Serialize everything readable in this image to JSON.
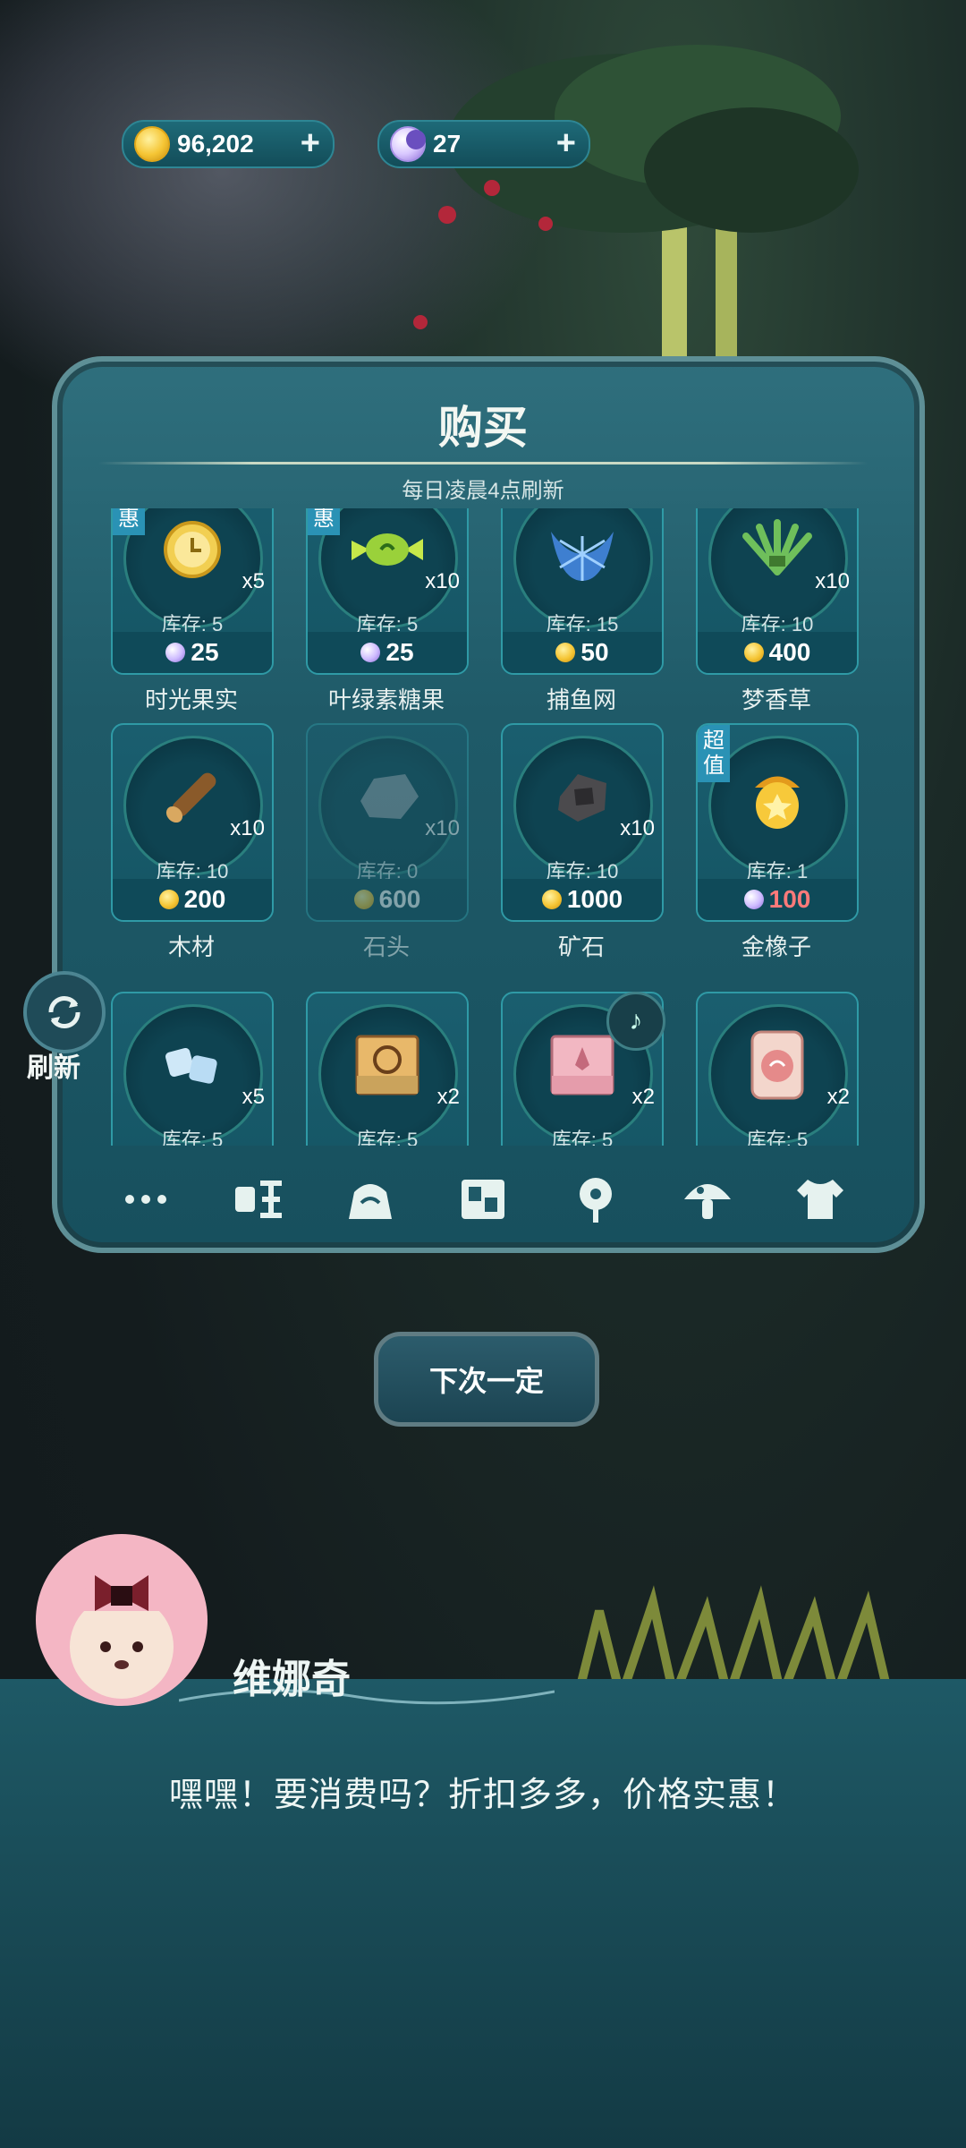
{
  "currencies": [
    {
      "icon": "gold-coin-icon",
      "amount": "96,202"
    },
    {
      "icon": "moon-gem-icon",
      "amount": "27"
    }
  ],
  "shop": {
    "title": "购买",
    "subtitle": "每日凌晨4点刷新",
    "items": [
      {
        "name": "时光果实",
        "qty": "x5",
        "stock": "库存: 5",
        "currency": "moon",
        "price": "25",
        "badge": "特惠"
      },
      {
        "name": "叶绿素糖果",
        "qty": "x10",
        "stock": "库存: 5",
        "currency": "moon",
        "price": "25",
        "badge": "特惠"
      },
      {
        "name": "捕鱼网",
        "qty": "",
        "stock": "库存: 15",
        "currency": "coin",
        "price": "50",
        "badge": ""
      },
      {
        "name": "梦香草",
        "qty": "x10",
        "stock": "库存: 10",
        "currency": "coin",
        "price": "400",
        "badge": ""
      },
      {
        "name": "木材",
        "qty": "x10",
        "stock": "库存: 10",
        "currency": "coin",
        "price": "200",
        "badge": ""
      },
      {
        "name": "石头",
        "qty": "x10",
        "stock": "库存: 0",
        "currency": "coin",
        "price": "600",
        "badge": "",
        "disabled": true
      },
      {
        "name": "矿石",
        "qty": "x10",
        "stock": "库存: 10",
        "currency": "coin",
        "price": "1000",
        "badge": ""
      },
      {
        "name": "金橡子",
        "qty": "",
        "stock": "库存: 1",
        "currency": "moon",
        "price": "100",
        "badge": "超值",
        "price_color": "red"
      },
      {
        "name": "",
        "qty": "x5",
        "stock": "库存: 5",
        "currency": "",
        "price": "",
        "badge": ""
      },
      {
        "name": "",
        "qty": "x2",
        "stock": "库存: 5",
        "currency": "",
        "price": "",
        "badge": ""
      },
      {
        "name": "",
        "qty": "x2",
        "stock": "库存: 5",
        "currency": "",
        "price": "",
        "badge": ""
      },
      {
        "name": "",
        "qty": "x2",
        "stock": "库存: 5",
        "currency": "",
        "price": "",
        "badge": ""
      }
    ],
    "tabs": [
      "more",
      "food",
      "bag",
      "furniture",
      "flower",
      "mushroom",
      "clothes"
    ]
  },
  "refresh_label": "刷新",
  "next_button": "下次一定",
  "dialog": {
    "speaker": "维娜奇",
    "text": "嘿嘿！要消费吗？折扣多多，价格实惠！"
  },
  "colors": {
    "panel": "#1f5a68",
    "accent_badge": "#2a92b5",
    "red_price": "#ff7a7a"
  }
}
